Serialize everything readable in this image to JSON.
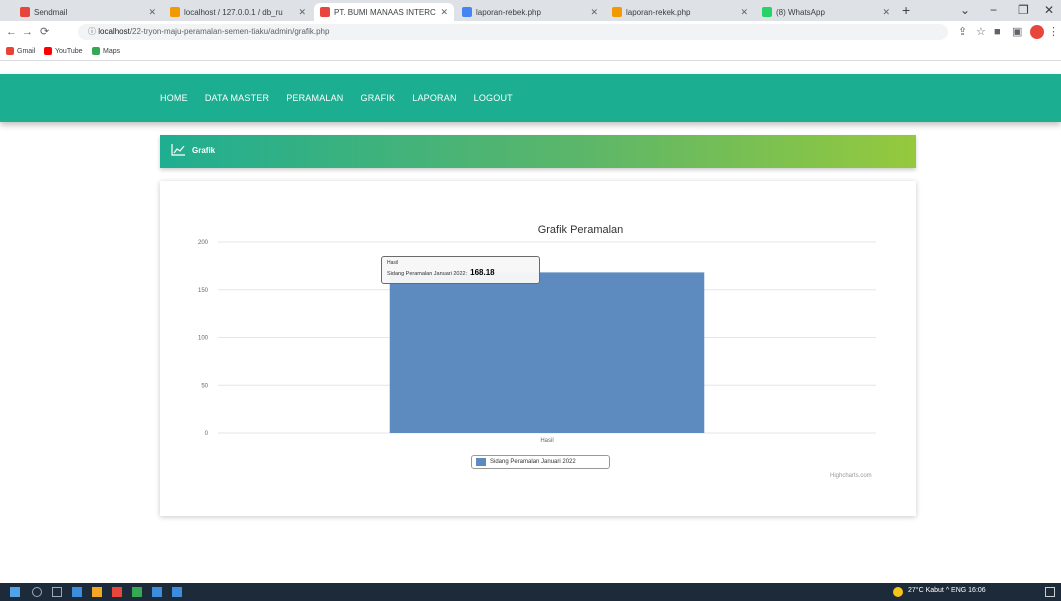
{
  "browser": {
    "tabs": [
      {
        "title": "Sendmail",
        "color": "#e8453c"
      },
      {
        "title": "localhost / 127.0.0.1 / db_ru",
        "color": "#f29900"
      },
      {
        "title": "PT. BUMI MANAAS INTERC",
        "color": "#e8453c",
        "active": true
      },
      {
        "title": "laporan-rebek.php",
        "color": "#4285f4"
      },
      {
        "title": "laporan-rekek.php",
        "color": "#f29900"
      },
      {
        "title": "(8) WhatsApp",
        "color": "#25d366"
      }
    ],
    "url_host": "localhost",
    "url_path": "/22-tryon-maju-peramalan-semen-tiaku/admin/grafik.php",
    "bookmarks": [
      {
        "label": "Gmail",
        "color": "#ea4335"
      },
      {
        "label": "YouTube",
        "color": "#ff0000"
      },
      {
        "label": "Maps",
        "color": "#34a853"
      }
    ]
  },
  "navbar": {
    "items": [
      "HOME",
      "DATA MASTER",
      "PERAMALAN",
      "GRAFIK",
      "LAPORAN",
      "LOGOUT"
    ]
  },
  "section": {
    "title": "Grafik"
  },
  "chart_data": {
    "type": "bar",
    "title": "Grafik Peramalan",
    "categories": [
      "Hasil"
    ],
    "series": [
      {
        "name": "Sidang Peramalan Januari 2022",
        "values": [
          168.18
        ],
        "color": "#5d8bbf"
      }
    ],
    "ylim": [
      0,
      200
    ],
    "yticks": [
      0,
      50,
      100,
      150,
      200
    ],
    "grid": true,
    "legend": "bottom-center",
    "tooltip": {
      "x": "Hasil",
      "series": "Sidang Peramalan Januari 2022",
      "value": "168.18"
    },
    "credits": "Highcharts.com"
  },
  "taskbar": {
    "system": "27°C Kabut  ^  ENG  16:06"
  }
}
